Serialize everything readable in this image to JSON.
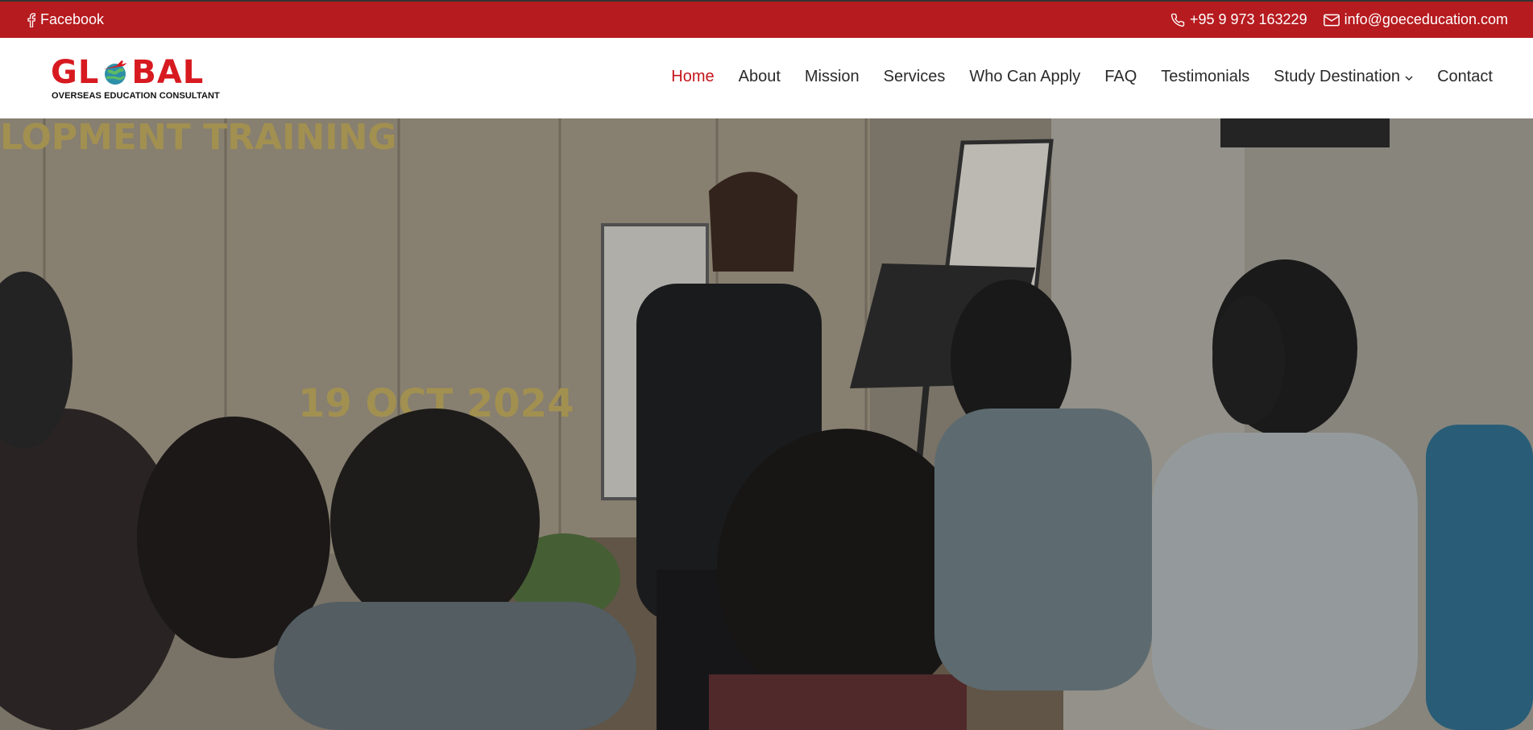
{
  "topbar": {
    "facebook_label": "Facebook",
    "phone": "+95 9 973 163229",
    "email": "info@goeceducation.com",
    "icons": {
      "facebook": "facebook-icon",
      "phone": "phone-icon",
      "email": "mail-icon"
    }
  },
  "logo": {
    "word_left": "GL",
    "word_right": "BAL",
    "subtitle": "OVERSEAS EDUCATION CONSULTANT"
  },
  "nav": {
    "items": [
      {
        "label": "Home",
        "active": true
      },
      {
        "label": "About"
      },
      {
        "label": "Mission"
      },
      {
        "label": "Services"
      },
      {
        "label": "Who Can Apply"
      },
      {
        "label": "FAQ"
      },
      {
        "label": "Testimonials"
      },
      {
        "label": "Study Destination",
        "dropdown": true
      },
      {
        "label": "Contact"
      }
    ]
  },
  "hero": {
    "banner_text": "LOPMENT TRAINING",
    "date_text": "19 OCT 2024"
  },
  "colors": {
    "brand_red": "#b61b1f",
    "logo_red": "#d71920",
    "nav_active": "#c4161c",
    "nav_text": "#2a2a2a"
  }
}
